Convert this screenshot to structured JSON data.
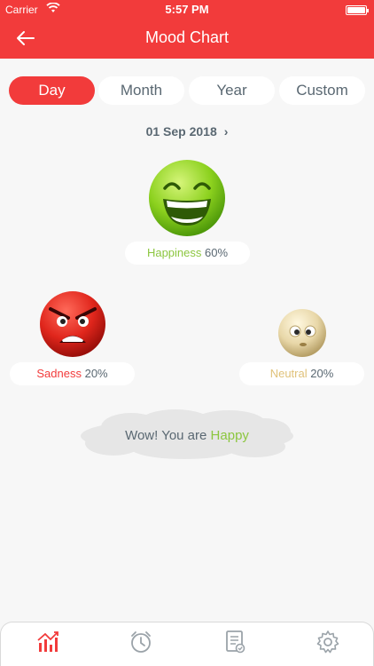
{
  "status": {
    "carrier": "Carrier",
    "time": "5:57 PM"
  },
  "header": {
    "title": "Mood Chart"
  },
  "tabs": [
    {
      "label": "Day",
      "active": true
    },
    {
      "label": "Month",
      "active": false
    },
    {
      "label": "Year",
      "active": false
    },
    {
      "label": "Custom",
      "active": false
    }
  ],
  "date": {
    "label": "01 Sep 2018"
  },
  "moods": {
    "happiness": {
      "label": "Happiness",
      "percent": "60%",
      "color": "#8cc63f"
    },
    "sadness": {
      "label": "Sadness",
      "percent": "20%",
      "color": "#f23b3b"
    },
    "neutral": {
      "label": "Neutral",
      "percent": "20%",
      "color": "#e0c27a"
    }
  },
  "summary": {
    "prefix": "Wow! You are",
    "mood": "Happy",
    "mood_color": "#8cc63f"
  },
  "bottom_nav": [
    {
      "icon": "chart-icon",
      "active": true
    },
    {
      "icon": "alarm-clock-icon",
      "active": false
    },
    {
      "icon": "report-icon",
      "active": false
    },
    {
      "icon": "settings-gear-icon",
      "active": false
    }
  ],
  "colors": {
    "accent": "#f23b3b",
    "text": "#5a6872",
    "background": "#f7f7f7"
  }
}
